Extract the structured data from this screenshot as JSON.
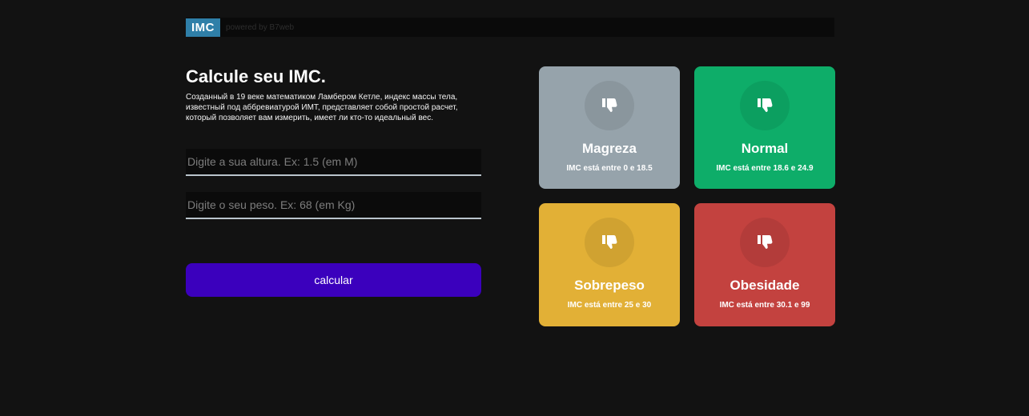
{
  "header": {
    "logo": "IMC",
    "powered": "powered by B7web"
  },
  "form": {
    "title": "Calcule seu IMC.",
    "description": "Созданный в 19 веке математиком Ламбером Кетле, индекс массы тела, известный под аббревиатурой ИМТ, представляет собой простой расчет, который позволяет вам измерить, имеет ли кто-то идеальный вес.",
    "height_placeholder": "Digite a sua altura. Ex: 1.5 (em M)",
    "weight_placeholder": "Digite o seu peso. Ex: 68 (em Kg)",
    "button_label": "calcular"
  },
  "cards": [
    {
      "name": "Magreza",
      "range_prefix": "IMC está entre",
      "min": "0",
      "and": "e",
      "max": "18.5",
      "color": "#96a3ab",
      "icon": "thumbs-down-icon"
    },
    {
      "name": "Normal",
      "range_prefix": "IMC está entre",
      "min": "18.6",
      "and": "e",
      "max": "24.9",
      "color": "#0ead69",
      "icon": "thumbs-down-icon"
    },
    {
      "name": "Sobrepeso",
      "range_prefix": "IMC está entre",
      "min": "25",
      "and": "e",
      "max": "30",
      "color": "#e2b036",
      "icon": "thumbs-down-icon"
    },
    {
      "name": "Obesidade",
      "range_prefix": "IMC está entre",
      "min": "30.1",
      "and": "e",
      "max": "99",
      "color": "#c3423f",
      "icon": "thumbs-down-icon"
    }
  ]
}
